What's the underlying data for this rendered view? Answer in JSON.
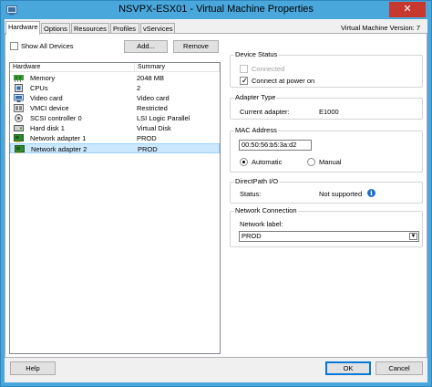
{
  "window": {
    "title": "NSVPX-ESX01 - Virtual Machine Properties",
    "close_glyph": "✕"
  },
  "tabs": [
    {
      "label": "Hardware",
      "active": true
    },
    {
      "label": "Options",
      "active": false
    },
    {
      "label": "Resources",
      "active": false
    },
    {
      "label": "Profiles",
      "active": false
    },
    {
      "label": "vServices",
      "active": false
    }
  ],
  "vm_version": "Virtual Machine Version: 7",
  "left": {
    "show_all_devices": "Show All Devices",
    "add_button": "Add...",
    "remove_button": "Remove",
    "columns": [
      "Hardware",
      "Summary"
    ],
    "rows": [
      {
        "name": "Memory",
        "summary": "2048 MB",
        "icon": "memory-icon",
        "selected": false
      },
      {
        "name": "CPUs",
        "summary": "2",
        "icon": "cpu-icon",
        "selected": false
      },
      {
        "name": "Video card",
        "summary": "Video card",
        "icon": "video-card-icon",
        "selected": false
      },
      {
        "name": "VMCI device",
        "summary": "Restricted",
        "icon": "vmci-icon",
        "selected": false
      },
      {
        "name": "SCSI controller 0",
        "summary": "LSI Logic Parallel",
        "icon": "scsi-icon",
        "selected": false
      },
      {
        "name": "Hard disk 1",
        "summary": "Virtual Disk",
        "icon": "disk-icon",
        "selected": false
      },
      {
        "name": "Network adapter 1",
        "summary": "PROD",
        "icon": "network-adapter-icon",
        "selected": false
      },
      {
        "name": "Network adapter 2",
        "summary": "PROD",
        "icon": "network-adapter-icon",
        "selected": true
      }
    ]
  },
  "right": {
    "device_status": {
      "title": "Device Status",
      "connected": "Connected",
      "connect_at_power_on": "Connect at power on"
    },
    "adapter_type": {
      "title": "Adapter Type",
      "label": "Current adapter:",
      "value": "E1000"
    },
    "mac": {
      "title": "MAC Address",
      "value": "00:50:56:b5:3a:d2",
      "automatic": "Automatic",
      "manual": "Manual"
    },
    "directpath": {
      "title": "DirectPath I/O",
      "label": "Status:",
      "value": "Not supported",
      "info_glyph": "i"
    },
    "network": {
      "title": "Network Connection",
      "label": "Network label:",
      "value": "PROD",
      "arrow": "▼"
    }
  },
  "footer": {
    "help": "Help",
    "ok": "OK",
    "cancel": "Cancel"
  },
  "colors": {
    "title_bar": "#4aa7dc",
    "close_button": "#c7382f",
    "selection": "#cce8ff"
  }
}
